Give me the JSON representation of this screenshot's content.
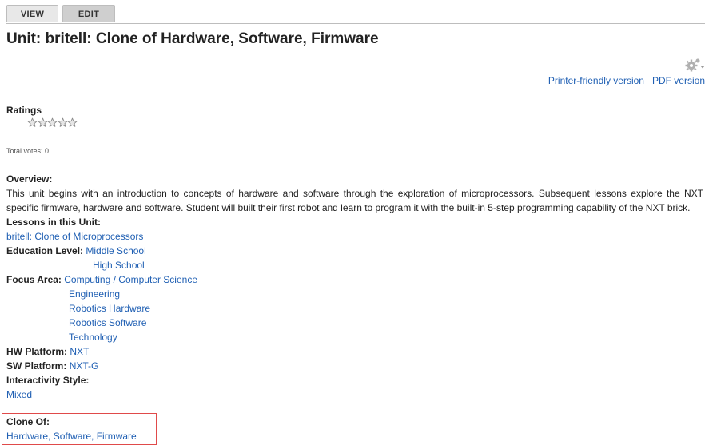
{
  "tabs": [
    {
      "label": "VIEW"
    },
    {
      "label": "EDIT"
    }
  ],
  "page": {
    "title": "Unit: britell: Clone of Hardware, Software, Firmware"
  },
  "print_links": {
    "printer_friendly": "Printer-friendly version",
    "pdf": "PDF version"
  },
  "ratings": {
    "label": "Ratings",
    "stars_total": 5,
    "stars_filled": 0,
    "total_votes": "Total votes: 0"
  },
  "overview": {
    "label": "Overview:",
    "text": "This unit begins with an introduction to concepts of hardware and software through the exploration of microprocessors. Subsequent lessons explore the NXT specific firmware, hardware and software. Student will built their first robot and learn to program it with the built-in 5-step programming capability of the NXT brick."
  },
  "lessons": {
    "label": "Lessons in this Unit:",
    "items": [
      "britell: Clone of Microprocessors"
    ]
  },
  "education_level": {
    "label": "Education Level:",
    "items": [
      "Middle School",
      "High School"
    ]
  },
  "focus_area": {
    "label": "Focus Area:",
    "items": [
      "Computing / Computer Science",
      "Engineering",
      "Robotics Hardware",
      "Robotics Software",
      "Technology"
    ]
  },
  "hw_platform": {
    "label": "HW Platform:",
    "value": "NXT"
  },
  "sw_platform": {
    "label": "SW Platform:",
    "value": "NXT-G"
  },
  "interactivity": {
    "label": "Interactivity Style:",
    "value": "Mixed"
  },
  "clone_of": {
    "label": "Clone Of:",
    "value": "Hardware, Software, Firmware"
  },
  "colors": {
    "link": "#1f5fb3",
    "highlight_border": "#e04a4a"
  }
}
